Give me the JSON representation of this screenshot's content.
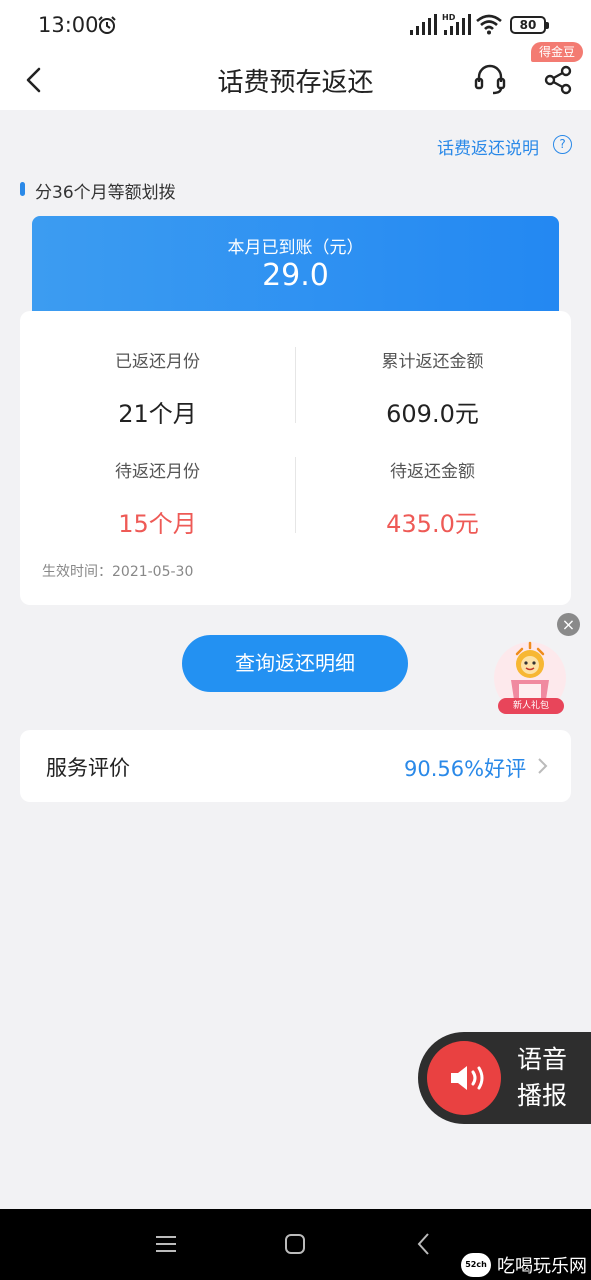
{
  "status_bar": {
    "time": "13:00",
    "battery": "80",
    "hd_label": "HD"
  },
  "header": {
    "title": "话费预存返还",
    "badge": "得金豆"
  },
  "explain": {
    "link": "话费返还说明",
    "icon_glyph": "?"
  },
  "section": {
    "title": "分36个月等额划拨"
  },
  "current_month": {
    "label": "本月已到账（元）",
    "amount": "29.0"
  },
  "stats": [
    {
      "label": "已返还月份",
      "value": "21个月"
    },
    {
      "label": "累计返还金额",
      "value": "609.0元"
    },
    {
      "label": "待返还月份",
      "value": "15个月"
    },
    {
      "label": "待返还金额",
      "value": "435.0元"
    }
  ],
  "effective_time": "生效时间：2021-05-30",
  "query_button": "查询返还明细",
  "review": {
    "label": "服务评价",
    "value": "90.56%好评"
  },
  "gift_float": {
    "label": "新人礼包"
  },
  "voice": {
    "label": "语音播报"
  },
  "watermark": {
    "logo": "52ch",
    "text": "吃喝玩乐网"
  },
  "colors": {
    "accent": "#2a89e8",
    "red_value": "#ee5a56",
    "voice_red": "#e94141"
  }
}
